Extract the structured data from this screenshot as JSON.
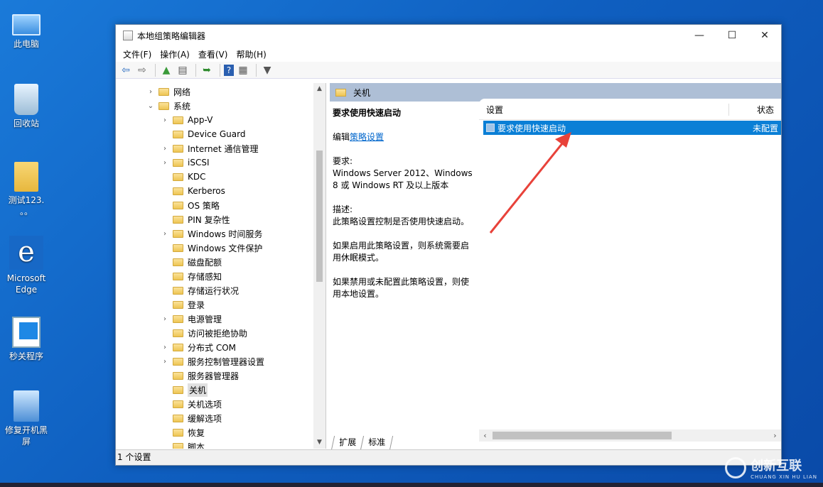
{
  "desktop": {
    "icons": [
      {
        "label": "此电脑",
        "icon": "computer-icon"
      },
      {
        "label": "回收站",
        "icon": "recycle-bin-icon"
      },
      {
        "label": "测试123.",
        "label2": "。。",
        "icon": "folder-icon"
      },
      {
        "label": "Microsoft",
        "label2": "Edge",
        "icon": "edge-icon"
      },
      {
        "label": "秒关程序",
        "icon": "app-shortcut-icon"
      },
      {
        "label": "修复开机黑",
        "label2": "屏",
        "icon": "setup-shortcut-icon"
      }
    ]
  },
  "window": {
    "title": "本地组策略编辑器",
    "controls": {
      "minimize": "—",
      "maximize": "☐",
      "close": "✕"
    },
    "menu": [
      "文件(F)",
      "操作(A)",
      "查看(V)",
      "帮助(H)"
    ],
    "toolbar": [
      "back-icon",
      "forward-icon",
      "up-folder-icon",
      "show-hide-tree-icon",
      "export-list-icon",
      "help-icon",
      "properties-icon",
      "filter-icon"
    ]
  },
  "tree": {
    "items": [
      {
        "label": "网络",
        "indent": 0,
        "expander": "collapsed"
      },
      {
        "label": "系统",
        "indent": 0,
        "expander": "expanded"
      },
      {
        "label": "App-V",
        "indent": 1,
        "expander": "collapsed"
      },
      {
        "label": "Device Guard",
        "indent": 1,
        "expander": "none"
      },
      {
        "label": "Internet 通信管理",
        "indent": 1,
        "expander": "collapsed"
      },
      {
        "label": "iSCSI",
        "indent": 1,
        "expander": "collapsed"
      },
      {
        "label": "KDC",
        "indent": 1,
        "expander": "none"
      },
      {
        "label": "Kerberos",
        "indent": 1,
        "expander": "none"
      },
      {
        "label": "OS 策略",
        "indent": 1,
        "expander": "none"
      },
      {
        "label": "PIN 复杂性",
        "indent": 1,
        "expander": "none"
      },
      {
        "label": "Windows 时间服务",
        "indent": 1,
        "expander": "collapsed"
      },
      {
        "label": "Windows 文件保护",
        "indent": 1,
        "expander": "none"
      },
      {
        "label": "磁盘配额",
        "indent": 1,
        "expander": "none"
      },
      {
        "label": "存储感知",
        "indent": 1,
        "expander": "none"
      },
      {
        "label": "存储运行状况",
        "indent": 1,
        "expander": "none"
      },
      {
        "label": "登录",
        "indent": 1,
        "expander": "none"
      },
      {
        "label": "电源管理",
        "indent": 1,
        "expander": "collapsed"
      },
      {
        "label": "访问被拒绝协助",
        "indent": 1,
        "expander": "none"
      },
      {
        "label": "分布式 COM",
        "indent": 1,
        "expander": "collapsed"
      },
      {
        "label": "服务控制管理器设置",
        "indent": 1,
        "expander": "collapsed"
      },
      {
        "label": "服务器管理器",
        "indent": 1,
        "expander": "none"
      },
      {
        "label": "关机",
        "indent": 1,
        "expander": "none",
        "selected": true
      },
      {
        "label": "关机选项",
        "indent": 1,
        "expander": "none"
      },
      {
        "label": "缓解选项",
        "indent": 1,
        "expander": "none"
      },
      {
        "label": "恢复",
        "indent": 1,
        "expander": "none"
      },
      {
        "label": "脚本",
        "indent": 1,
        "expander": "none"
      }
    ]
  },
  "right": {
    "header": "关机",
    "desc": {
      "title": "要求使用快速启动",
      "edit_prefix": "编辑",
      "edit_link": "策略设置",
      "req_label": "要求:",
      "req_text": "Windows Server 2012、Windows 8 或 Windows RT 及以上版本",
      "desc_label": "描述:",
      "desc_text": "此策略设置控制是否使用快速启动。",
      "p1": "如果启用此策略设置，则系统需要启用休眠模式。",
      "p2": "如果禁用或未配置此策略设置，则使用本地设置。"
    },
    "list": {
      "col_setting": "设置",
      "col_state": "状态",
      "rows": [
        {
          "setting": "要求使用快速启动",
          "state": "未配置"
        }
      ]
    },
    "tabs": [
      "扩展",
      "标准"
    ]
  },
  "status": "1 个设置",
  "watermark": {
    "name": "创新互联",
    "sub": "CHUANG XIN HU LIAN"
  },
  "colors": {
    "selection": "#0a7fd6",
    "header": "#aebfd6",
    "annotation_arrow": "#e8423a"
  }
}
